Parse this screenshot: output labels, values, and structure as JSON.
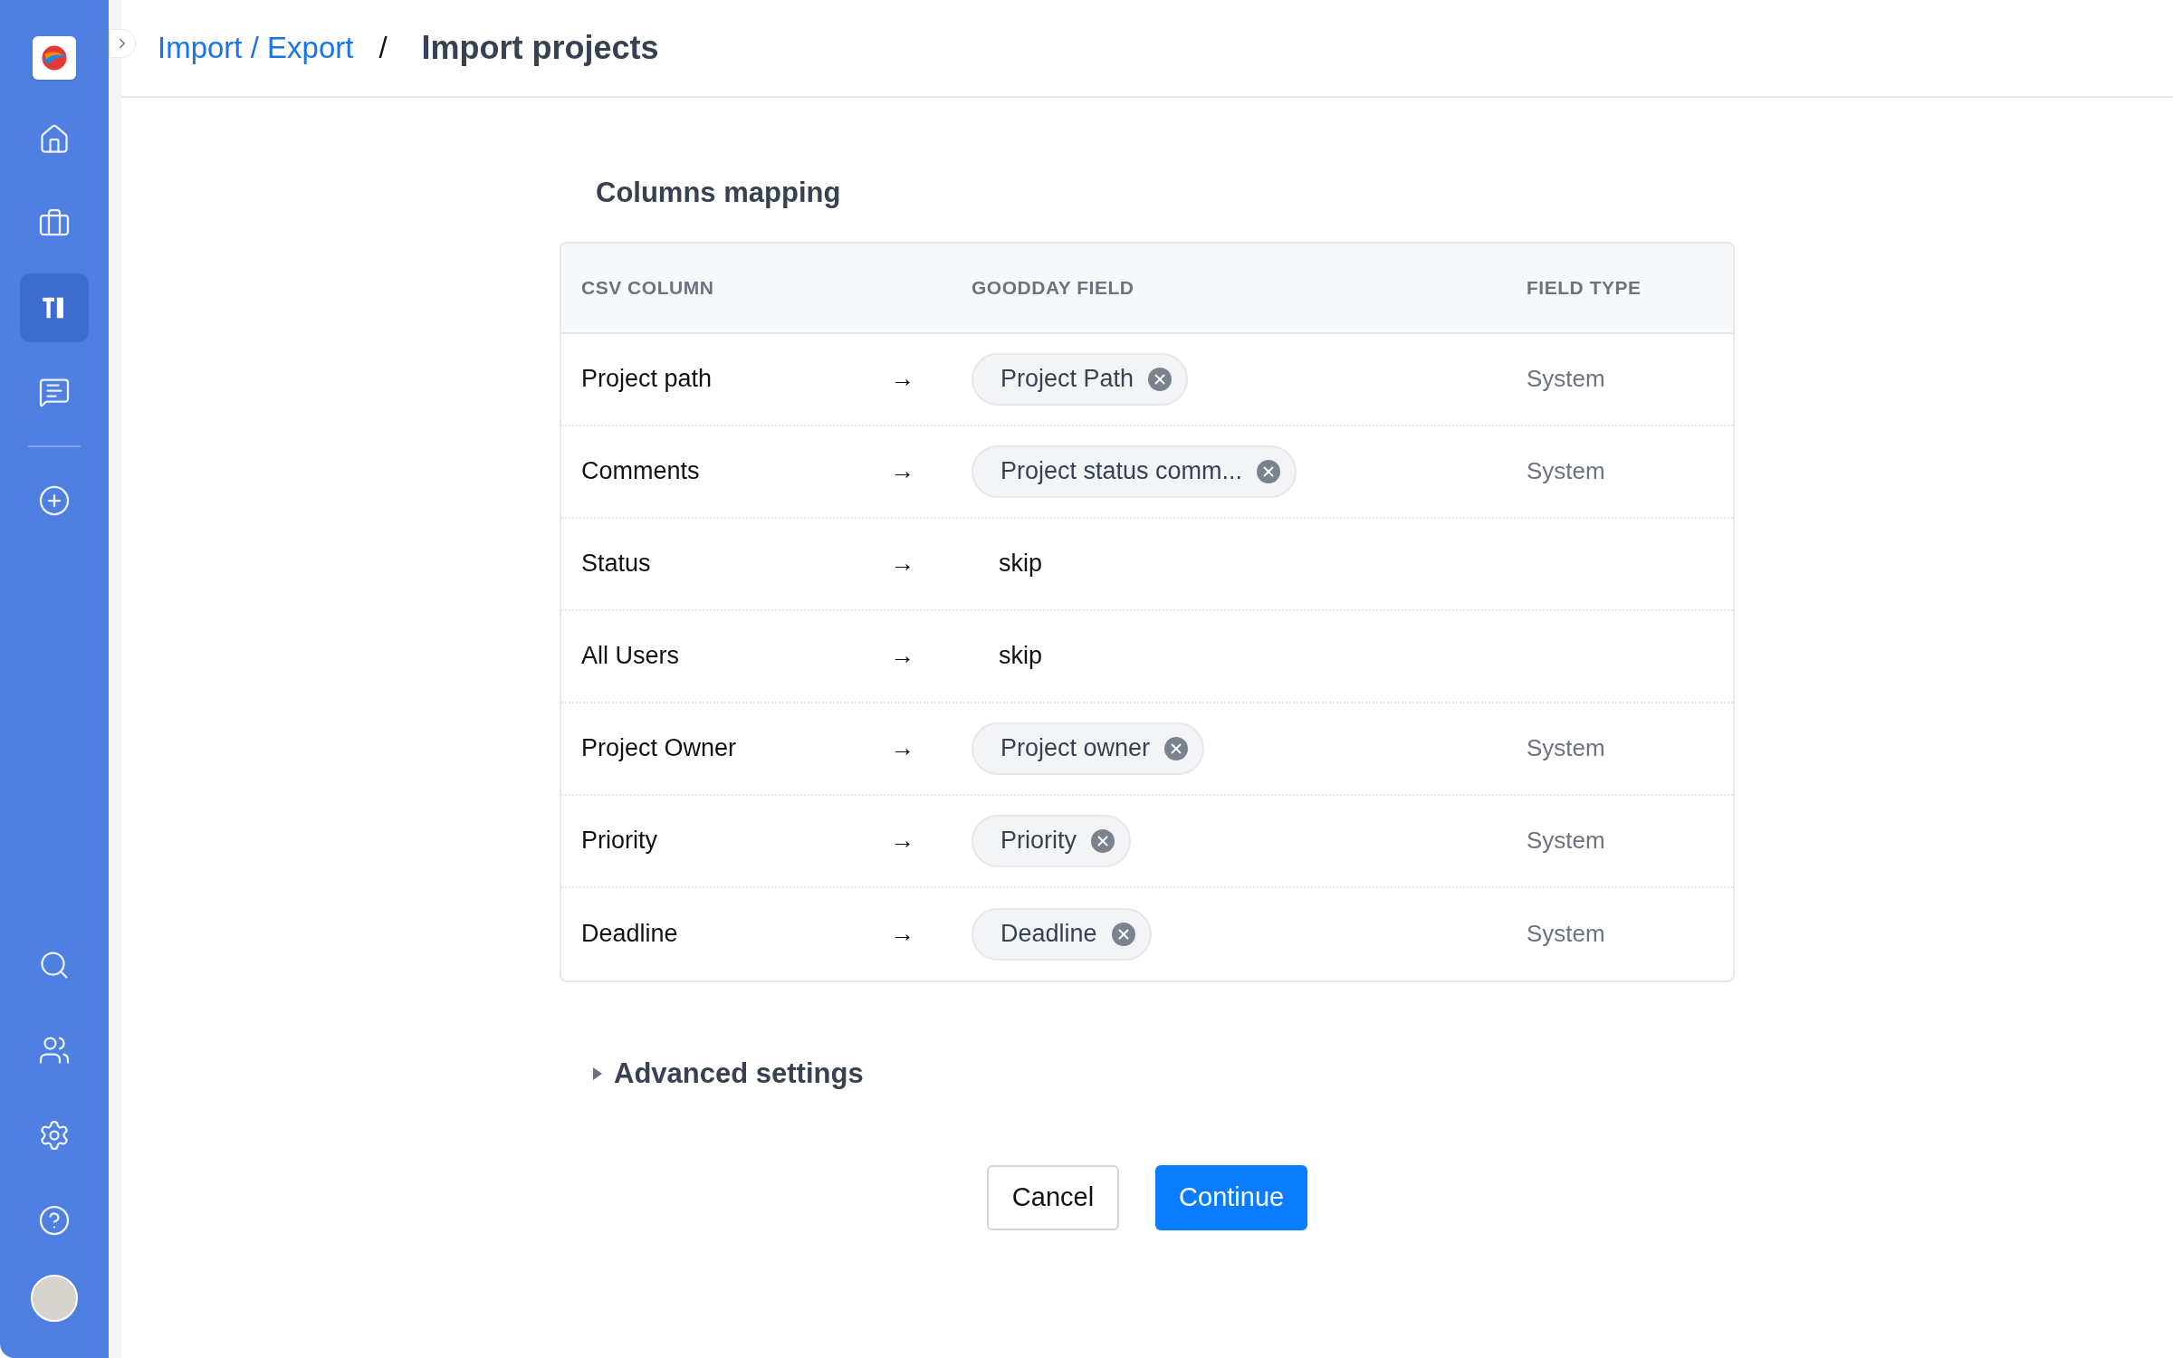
{
  "sidebar": {
    "top_items": [
      {
        "kind": "home",
        "selected": false
      },
      {
        "kind": "briefcase",
        "selected": false
      },
      {
        "kind": "tools",
        "selected": true
      },
      {
        "kind": "chat",
        "selected": false
      },
      {
        "kind": "plus",
        "selected": false
      }
    ],
    "bottom_items": [
      {
        "kind": "search",
        "selected": false
      },
      {
        "kind": "users",
        "selected": false
      },
      {
        "kind": "settings",
        "selected": false
      },
      {
        "kind": "help",
        "selected": false
      }
    ]
  },
  "breadcrumb": {
    "parent": "Import / Export",
    "separator": "/",
    "current": "Import projects"
  },
  "section_title": "Columns mapping",
  "table": {
    "columns": [
      "CSV COLUMN",
      "GOODDAY FIELD",
      "FIELD TYPE"
    ],
    "rows": [
      {
        "csv_column": "Project path",
        "arrow": "→",
        "kind": "chip",
        "goodday_field": "Project Path",
        "field_type": "System"
      },
      {
        "csv_column": "Comments",
        "arrow": "→",
        "kind": "chip",
        "goodday_field": "Project status comm...",
        "field_type": "System"
      },
      {
        "csv_column": "Status",
        "arrow": "→",
        "kind": "skip",
        "goodday_field": "skip"
      },
      {
        "csv_column": "All Users",
        "arrow": "→",
        "kind": "skip",
        "goodday_field": "skip"
      },
      {
        "csv_column": "Project Owner",
        "arrow": "→",
        "kind": "chip",
        "goodday_field": "Project owner",
        "field_type": "System"
      },
      {
        "csv_column": "Priority",
        "arrow": "→",
        "kind": "chip",
        "goodday_field": "Priority",
        "field_type": "System"
      },
      {
        "csv_column": "Deadline",
        "arrow": "→",
        "kind": "chip",
        "goodday_field": "Deadline",
        "field_type": "System"
      }
    ]
  },
  "advanced_settings": {
    "label": "Advanced settings",
    "expanded": false
  },
  "buttons": {
    "cancel": "Cancel",
    "continue": "Continue"
  }
}
